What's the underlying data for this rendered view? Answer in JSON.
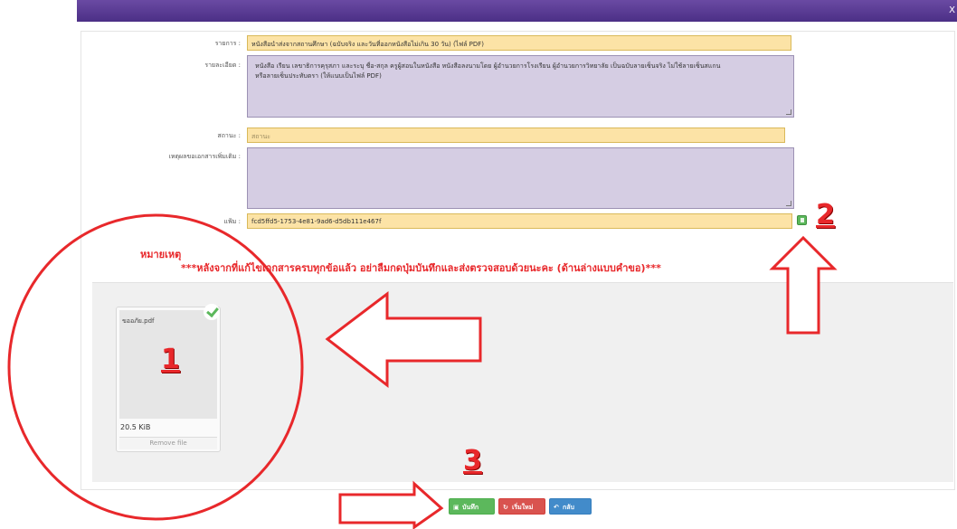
{
  "window": {
    "close_glyph": "X"
  },
  "form": {
    "item": {
      "label": "รายการ :",
      "value": "หนังสือนำส่งจากสถานศึกษา (ฉบับจริง และวันที่ออกหนังสือไม่เกิน 30 วัน) (ไฟล์ PDF)"
    },
    "detail": {
      "label": "รายละเอียด :",
      "line1": "หนังสือ เรียน เลขาธิการคุรุสภา  และระบุ ชื่อ-สกุล ครูผู้สอนในหนังสือ หนังสือลงนามโดย ผู้อำนวยการโรงเรียน ผู้อำนวยการวิทยาลัย เป็นฉบับลายเซ็นจริง ไม่ใช้ลายเซ็นสแกน",
      "line2": "หรือลายเซ็นประทับตรา  (ให้แนบเป็นไฟล์ PDF)"
    },
    "status": {
      "label": "สถานะ :",
      "placeholder": "สถานะ"
    },
    "reason": {
      "label": "เหตุผลขอเอกสารเพิ่มเติม :",
      "value": ""
    },
    "file": {
      "label": "แฟ้ม :",
      "value": "fcd5ffd5-1753-4e81-9ad6-d5db111e467f"
    }
  },
  "note": {
    "title": "หมายเหตุ",
    "text": "***หลังจากที่แก้ไขเอกสารครบทุกข้อแล้ว อย่าลืมกดปุ่มบันทึกและส่งตรวจสอบด้วยนะคะ (ด้านล่างแบบคำขอ)***"
  },
  "upload": {
    "file_name": "ขออภัย.pdf",
    "file_size": "20.5 KiB",
    "remove_label": "Remove file"
  },
  "annotations": {
    "n1": "1",
    "n2": "2",
    "n3": "3"
  },
  "buttons": {
    "save": "บันทึก",
    "reset": "เริ่มใหม่",
    "back": "กลับ"
  },
  "icons": [
    "save-icon",
    "refresh-icon",
    "back-icon",
    "check-icon",
    "file-icon"
  ],
  "colors": {
    "field_bg": "#fce3a6",
    "area_bg": "#d5cde3",
    "annotation_red": "#e8282b",
    "header": "#4b2f86"
  }
}
